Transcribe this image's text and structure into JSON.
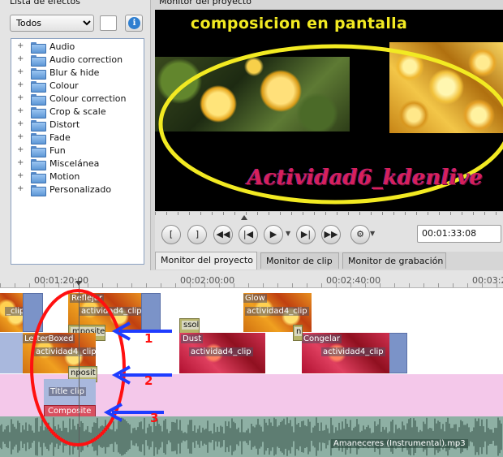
{
  "effects_panel": {
    "title": "Lista de efectos",
    "filter_value": "Todos",
    "info_icon": "info-icon",
    "items": [
      {
        "label": "Audio"
      },
      {
        "label": "Audio correction"
      },
      {
        "label": "Blur & hide"
      },
      {
        "label": "Colour"
      },
      {
        "label": "Colour correction"
      },
      {
        "label": "Crop & scale"
      },
      {
        "label": "Distort"
      },
      {
        "label": "Fade"
      },
      {
        "label": "Fun"
      },
      {
        "label": "Miscelánea"
      },
      {
        "label": "Motion"
      },
      {
        "label": "Personalizado"
      }
    ],
    "expander": "+"
  },
  "monitor": {
    "title": "Monitor del proyecto",
    "screen": {
      "headline": "composicion en pantalla",
      "overlay_title": "Actividad6_kdenlive",
      "annotation_color": "#f2ea22"
    },
    "timecode": "00:01:33:08",
    "tabs": [
      {
        "label": "Monitor del proyecto",
        "active": true
      },
      {
        "label": "Monitor de clip",
        "active": false
      },
      {
        "label": "Monitor de grabación",
        "active": false
      }
    ]
  },
  "timeline": {
    "ruler_labels": [
      "00:01:20:00",
      "00:02:00:00",
      "00:02:40:00",
      "00:03:2"
    ],
    "tracks": {
      "v1": {
        "clips": [
          {
            "label": "_clip"
          },
          {
            "label": "Reflejar"
          },
          {
            "label": "actividad4_clip"
          },
          {
            "label": "Glow"
          },
          {
            "label": "actividad4_clip"
          }
        ]
      },
      "v2": {
        "clips": [
          {
            "label": "mposite"
          },
          {
            "label": "ssol"
          },
          {
            "label": "LetterBoxed"
          },
          {
            "label": "actividad4_clip"
          },
          {
            "label": "Dust"
          },
          {
            "label": "actividad4_clip"
          },
          {
            "label": "Congelar"
          },
          {
            "label": "actividad4_clip"
          },
          {
            "label": "n"
          }
        ]
      },
      "v3": {
        "clips": [
          {
            "label": "nposit"
          },
          {
            "label": "Title clip"
          },
          {
            "label": "Composite"
          }
        ]
      },
      "audio": {
        "label": "Amaneceres (Instrumental).mp3"
      }
    },
    "annotation_numbers": [
      "1",
      "2",
      "3"
    ],
    "colors": {
      "annotation_red": "#ff1010",
      "annotation_blue": "#1e3cff",
      "title_track_bg": "#f4c8ea",
      "audio_bg": "#8eb0a4"
    }
  }
}
